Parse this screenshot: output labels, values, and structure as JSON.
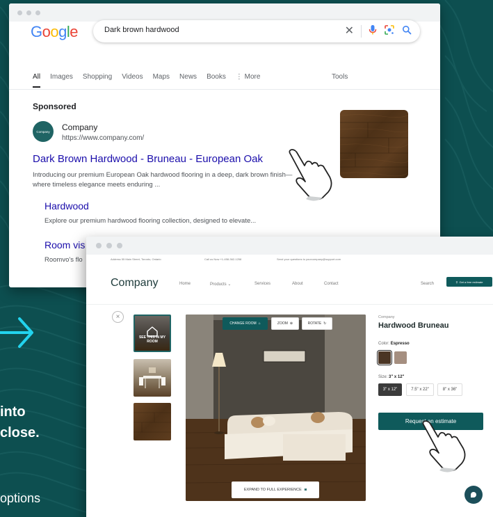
{
  "colors": {
    "background": "#0d4f50",
    "brand": "#0f5a5b",
    "link": "#1a0dab",
    "google_blue": "#4285F4",
    "google_red": "#EA4335",
    "google_yellow": "#FBBC05",
    "google_green": "#34A853",
    "wood_dark": "#4d3117",
    "swatch_espresso": "#4a3524",
    "swatch_taupe": "#a58f80"
  },
  "google": {
    "logo_letters": [
      "G",
      "o",
      "o",
      "g",
      "l",
      "e"
    ],
    "query": "Dark brown hardwood",
    "icons": [
      "close-icon",
      "mic-icon",
      "lens-icon",
      "search-icon"
    ],
    "tabs": [
      "All",
      "Images",
      "Shopping",
      "Videos",
      "Maps",
      "News",
      "Books",
      "⋮ More"
    ],
    "tools_label": "Tools",
    "sponsored_label": "Sponsored",
    "company_logo_text": "Company",
    "company_name": "Company",
    "company_url": "https://www.company.com/",
    "ad_title": "Dark Brown Hardwood - Bruneau - European Oak",
    "ad_description": "Introducing our premium European Oak hardwood flooring in a deep, dark brown finish—where timeless elegance meets enduring ...",
    "sitelinks": [
      {
        "title": "Hardwood",
        "description": "Explore our premium hardwood flooring collection, designed to elevate..."
      },
      {
        "title": "Room vis",
        "description": "Roomvo's flo"
      }
    ]
  },
  "hero": {
    "line1": "into",
    "line2": "close.",
    "subtitle": "options"
  },
  "site": {
    "topbar": {
      "address": "Address 55 Main Street, Toronto, Ontario",
      "phone": "Call us Now +1-458-362-1258",
      "email": "Send your questions to yourcompany@support.com"
    },
    "logo": "Company",
    "nav": [
      "Home",
      "Products ⌄",
      "Services",
      "About",
      "Contact"
    ],
    "search_label": "Search",
    "cta_label": "Get a free estimate",
    "thumbnail_label": "SEE THIS IN MY ROOM",
    "room_controls": {
      "change_room": "CHANGE ROOM",
      "zoom": "ZOOM",
      "rotate": "ROTATE"
    },
    "expand_label": "EXPAND TO FULL EXPERIENCE",
    "product": {
      "brand": "Company",
      "name": "Hardwood Bruneau",
      "color_label": "Color:",
      "color_value": "Espresso",
      "size_label": "Size:",
      "size_value": "3\" x 12\"",
      "sizes": [
        "3\" x 12\"",
        "7.5\" x 22\"",
        "8\" x 36\""
      ],
      "estimate_button": "Request an estimate"
    }
  }
}
